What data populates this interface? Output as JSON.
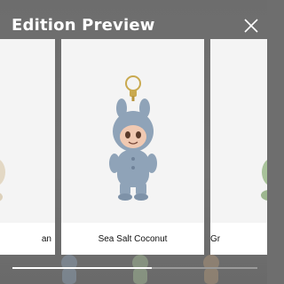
{
  "header": {
    "title": "Edition Preview",
    "close_icon": "close-icon"
  },
  "carousel": {
    "cards": [
      {
        "label": "an"
      },
      {
        "label": "Sea Salt Coconut"
      },
      {
        "label": "Gr"
      }
    ],
    "scroll_progress": 0.57
  },
  "colors": {
    "overlay": "#6e6e6e",
    "card": "#f6f6f6",
    "plush_blue": "#8fa3b8",
    "plush_green": "#a8c29a",
    "plush_cream": "#e8dcc7",
    "keyring": "#c9a94f"
  }
}
